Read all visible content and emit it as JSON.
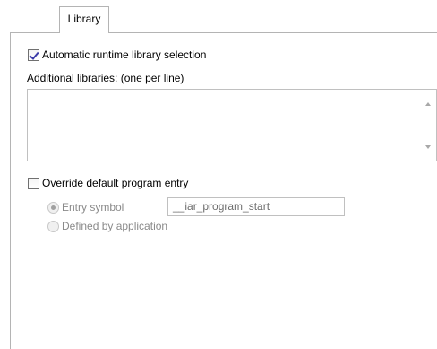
{
  "tabs": [
    {
      "label": "Library",
      "active": true
    }
  ],
  "library": {
    "auto_runtime": {
      "label": "Automatic runtime library selection",
      "checked": true
    },
    "additional_libraries": {
      "label": "Additional libraries: (one per line)",
      "value": ""
    },
    "override_entry": {
      "label": "Override default program entry",
      "checked": false
    },
    "entry_symbol": {
      "label": "Entry symbol",
      "selected": true,
      "enabled": false
    },
    "entry_symbol_value": "__iar_program_start",
    "defined_by_app": {
      "label": "Defined by application",
      "selected": false,
      "enabled": false
    }
  },
  "icons": {
    "scroll_up": "scroll-up-arrow-icon",
    "scroll_down": "scroll-down-arrow-icon"
  }
}
